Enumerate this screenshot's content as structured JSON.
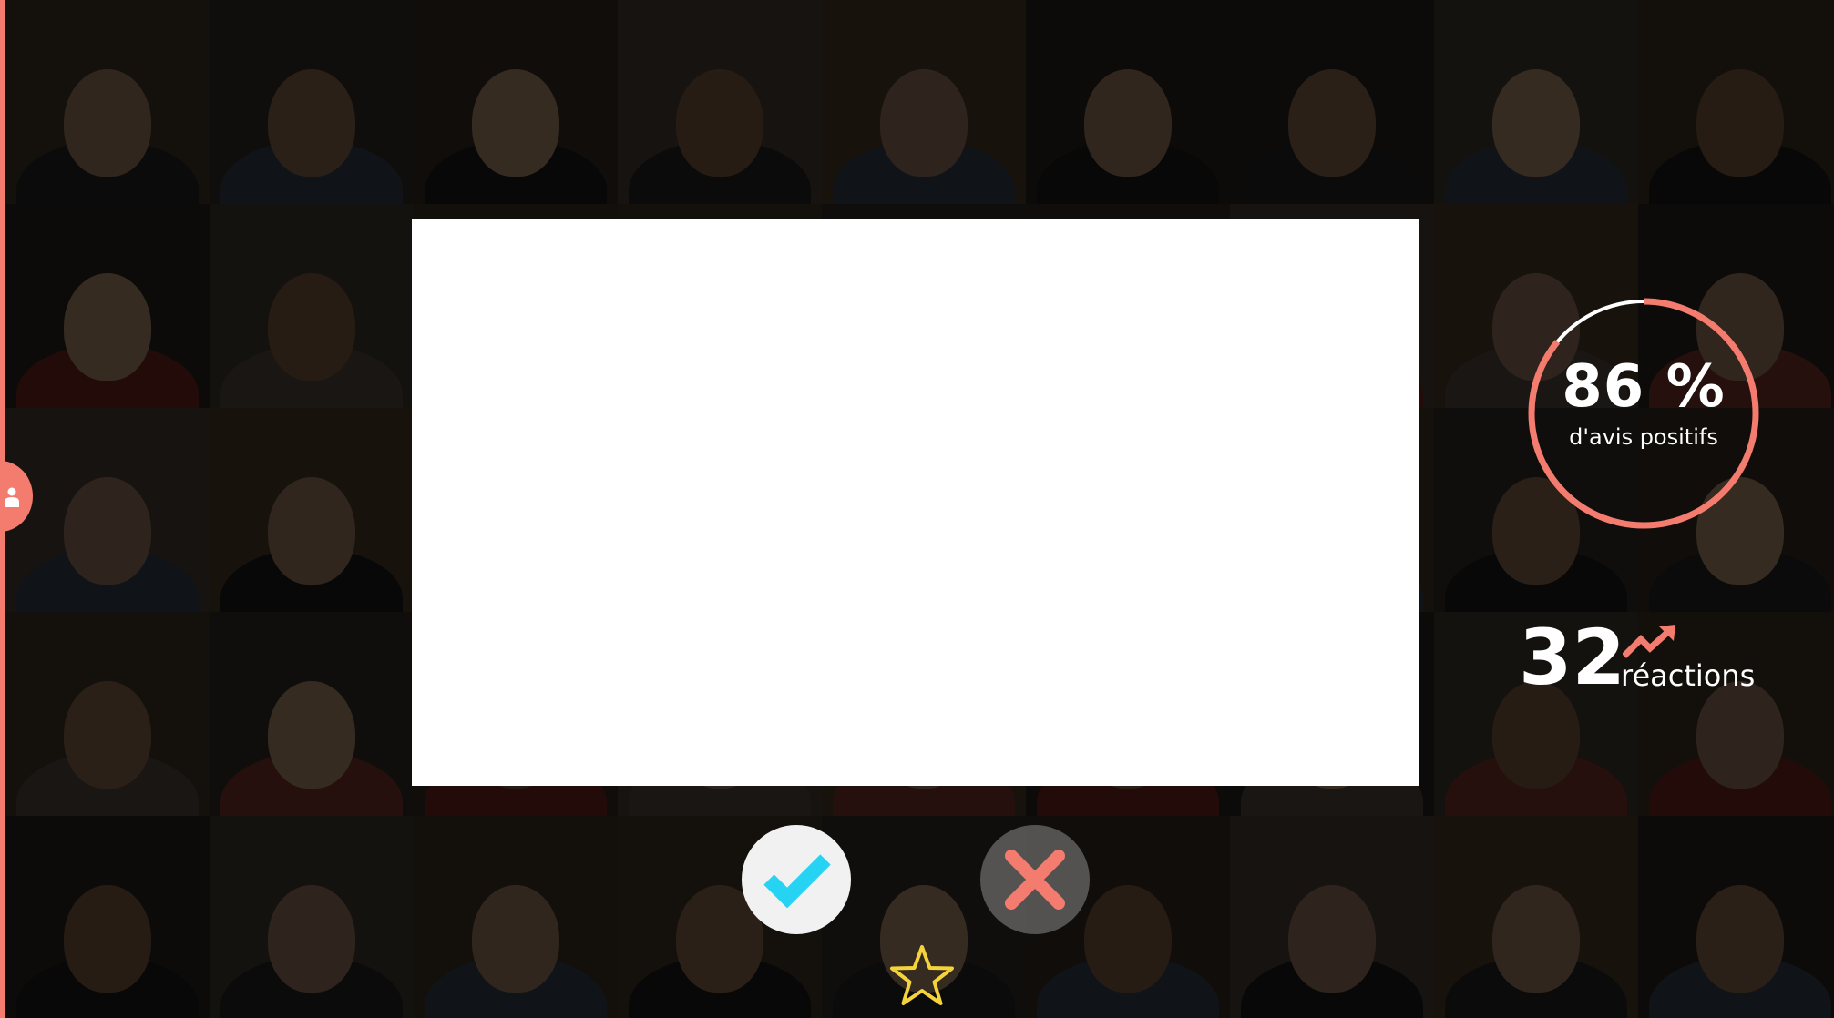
{
  "colors": {
    "accent": "#f47c6e",
    "approve_check": "#27d3f2",
    "reject_cross": "#f47c6e",
    "star_outline": "#f5d33b",
    "ring_track": "#ffffff",
    "panel": "#ffffff"
  },
  "icons": {
    "user": "user-icon",
    "approve": "checkmark-icon",
    "reject": "close-icon",
    "favorite": "star-outline-icon",
    "trend": "trending-up-icon"
  },
  "approval": {
    "value": "86 %",
    "label": "d'avis positifs",
    "fraction": 0.86
  },
  "reactions": {
    "count": "32",
    "label": "réactions"
  }
}
